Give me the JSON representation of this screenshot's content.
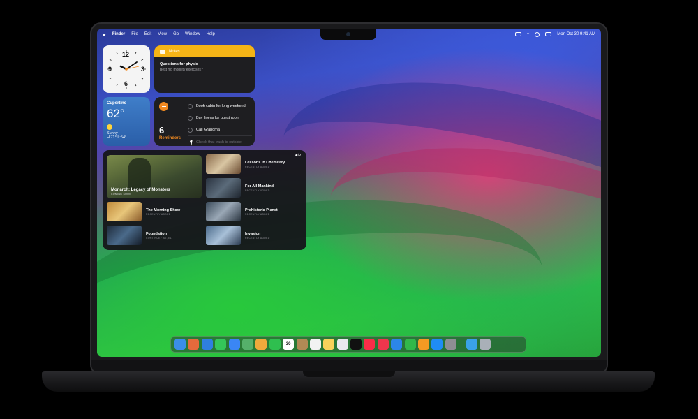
{
  "menubar": {
    "apple": "",
    "items": [
      "Finder",
      "File",
      "Edit",
      "View",
      "Go",
      "Window",
      "Help"
    ],
    "datetime": "Mon Oct 30  9:41 AM"
  },
  "clock": {
    "n12": "12",
    "n3": "3",
    "n6": "6",
    "n9": "9"
  },
  "notes": {
    "header": "Notes",
    "title": "Questions for physio",
    "subtitle": "Best hip mobility exercises?"
  },
  "weather": {
    "city": "Cupertino",
    "temp": "62°",
    "condition": "Sunny",
    "hilo": "H:71° L:54°"
  },
  "reminders": {
    "count": "6",
    "label": "Reminders",
    "items": [
      "Book cabin for long weekend",
      "Buy linens for guest room",
      "Call Grandma",
      "Check that trash is outside"
    ]
  },
  "tv": {
    "logo": "tv",
    "featured": {
      "title": "Monarch: Legacy of Monsters",
      "subtitle": "COMING SOON"
    },
    "items": [
      {
        "title": "Lessons in Chemistry",
        "subtitle": "RECENTLY ADDED"
      },
      {
        "title": "For All Mankind",
        "subtitle": "RECENTLY ADDED"
      },
      {
        "title": "The Morning Show",
        "subtitle": "RECENTLY ADDED"
      },
      {
        "title": "Prehistoric Planet",
        "subtitle": "RECENTLY ADDED"
      },
      {
        "title": "Foundation",
        "subtitle": "CONTINUE · S2, E1"
      },
      {
        "title": "Invasion",
        "subtitle": "RECENTLY ADDED"
      }
    ]
  },
  "dock": {
    "calendar_day": "30",
    "apps": [
      {
        "name": "finder-icon",
        "color": "#3b8ee8"
      },
      {
        "name": "launchpad-icon",
        "color": "#e56a3c"
      },
      {
        "name": "safari-icon",
        "color": "#2f7fe0"
      },
      {
        "name": "messages-icon",
        "color": "#34c759"
      },
      {
        "name": "mail-icon",
        "color": "#3a86f5"
      },
      {
        "name": "maps-icon",
        "color": "#56b06a"
      },
      {
        "name": "photos-icon",
        "color": "#f0a93c"
      },
      {
        "name": "facetime-icon",
        "color": "#2fbf4f"
      },
      {
        "name": "calendar-icon",
        "color": "#ffffff"
      },
      {
        "name": "contacts-icon",
        "color": "#b08a55"
      },
      {
        "name": "reminders-icon",
        "color": "#f2f2f2"
      },
      {
        "name": "notes-icon",
        "color": "#f7d25a"
      },
      {
        "name": "freeform-icon",
        "color": "#e9e9ee"
      },
      {
        "name": "tv-icon",
        "color": "#111111"
      },
      {
        "name": "music-icon",
        "color": "#fa2d48"
      },
      {
        "name": "news-icon",
        "color": "#f0364d"
      },
      {
        "name": "keynote-icon",
        "color": "#2c86e8"
      },
      {
        "name": "numbers-icon",
        "color": "#32b84a"
      },
      {
        "name": "pages-icon",
        "color": "#f59a23"
      },
      {
        "name": "app-store-icon",
        "color": "#1f8cf5"
      },
      {
        "name": "system-settings-icon",
        "color": "#8e8e93"
      }
    ],
    "right": [
      {
        "name": "downloads-folder-icon",
        "color": "#3aa2e8"
      },
      {
        "name": "trash-icon",
        "color": "#a9b0b8"
      }
    ]
  }
}
